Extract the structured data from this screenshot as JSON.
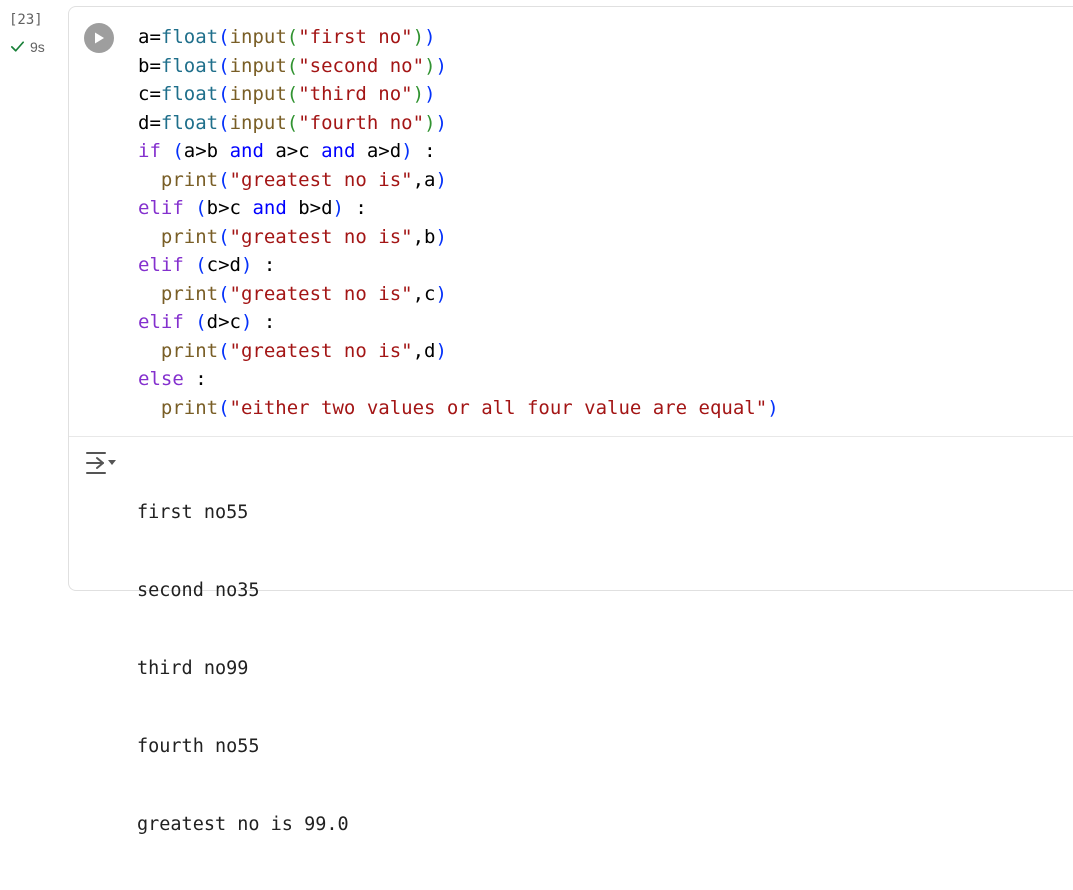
{
  "cell": {
    "execution_count": "[23]",
    "status_duration": "9s",
    "status_icon": "check-icon",
    "run_icon": "play-icon",
    "output_icon": "output-collapse-icon"
  },
  "code": {
    "line1": {
      "var": "a",
      "eq": "=",
      "fn": "float",
      "p1": "(",
      "bi": "input",
      "p2": "(",
      "str": "\"first no\"",
      "p3": ")",
      "p4": ")"
    },
    "line2": {
      "var": "b",
      "eq": "=",
      "fn": "float",
      "p1": "(",
      "bi": "input",
      "p2": "(",
      "str": "\"second no\"",
      "p3": ")",
      "p4": ")"
    },
    "line3": {
      "var": "c",
      "eq": "=",
      "fn": "float",
      "p1": "(",
      "bi": "input",
      "p2": "(",
      "str": "\"third no\"",
      "p3": ")",
      "p4": ")"
    },
    "line4": {
      "var": "d",
      "eq": "=",
      "fn": "float",
      "p1": "(",
      "bi": "input",
      "p2": "(",
      "str": "\"fourth no\"",
      "p3": ")",
      "p4": ")"
    },
    "line5": {
      "kw": "if",
      "sp": " ",
      "p1": "(",
      "c1": "a>b ",
      "and1": "and",
      "c2": " a>c ",
      "and2": "and",
      "c3": " a>d",
      "p2": ")",
      "tail": " :"
    },
    "line6": {
      "indent": "  ",
      "bi": "print",
      "p1": "(",
      "str": "\"greatest no is\"",
      "rest": ",a",
      "p2": ")"
    },
    "line7": {
      "kw": "elif",
      "sp": " ",
      "p1": "(",
      "c1": "b>c ",
      "and1": "and",
      "c2": " b>d",
      "p2": ")",
      "tail": " :"
    },
    "line8": {
      "indent": "  ",
      "bi": "print",
      "p1": "(",
      "str": "\"greatest no is\"",
      "rest": ",b",
      "p2": ")"
    },
    "line9": {
      "kw": "elif",
      "sp": " ",
      "p1": "(",
      "c1": "c>d",
      "p2": ")",
      "tail": " :"
    },
    "line10": {
      "indent": "  ",
      "bi": "print",
      "p1": "(",
      "str": "\"greatest no is\"",
      "rest": ",c",
      "p2": ")"
    },
    "line11": {
      "kw": "elif",
      "sp": " ",
      "p1": "(",
      "c1": "d>c",
      "p2": ")",
      "tail": " :"
    },
    "line12": {
      "indent": "  ",
      "bi": "print",
      "p1": "(",
      "str": "\"greatest no is\"",
      "rest": ",d",
      "p2": ")"
    },
    "line13": {
      "kw": "else",
      "tail": " :"
    },
    "line14": {
      "indent": "  ",
      "bi": "print",
      "p1": "(",
      "str": "\"either two values or all four value are equal\"",
      "p2": ")"
    }
  },
  "output": {
    "lines": [
      "first no55",
      "second no35",
      "third no99",
      "fourth no55",
      "greatest no is 99.0"
    ]
  },
  "colors": {
    "keyword": "#8430ce",
    "logic_operator": "#0000ff",
    "function_call": "#1f6f8b",
    "builtin": "#795e26",
    "string": "#a31515",
    "bracket_outer": "#0431fa",
    "bracket_inner": "#319331",
    "status_ok": "#188038"
  }
}
